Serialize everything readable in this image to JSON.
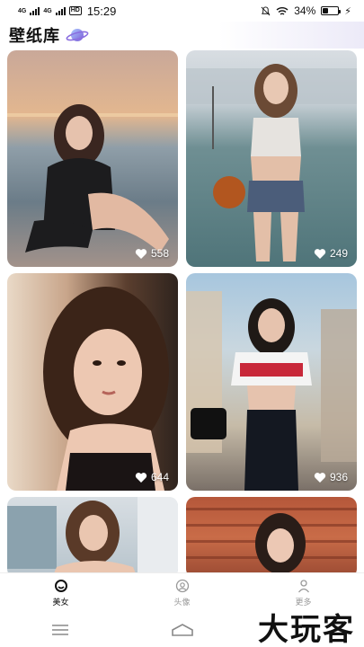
{
  "status_bar": {
    "network_left": "4G",
    "network_right": "4G",
    "hd": "HD",
    "time": "15:29",
    "battery": "34%",
    "battery_level": 0.34
  },
  "header": {
    "title": "壁纸库",
    "icon": "planet-icon"
  },
  "cards": [
    {
      "likes": "558"
    },
    {
      "likes": "249"
    },
    {
      "likes": "644"
    },
    {
      "likes": "936"
    },
    {
      "likes": ""
    },
    {
      "likes": ""
    }
  ],
  "tabs": [
    {
      "label": "美女",
      "icon": "smile-tab-icon",
      "active": true
    },
    {
      "label": "头像",
      "icon": "avatar-tab-icon",
      "active": false
    },
    {
      "label": "更多",
      "icon": "user-tab-icon",
      "active": false
    }
  ],
  "watermark": "大玩客",
  "colors": {
    "accent": "#111111",
    "inactive": "#999999"
  }
}
